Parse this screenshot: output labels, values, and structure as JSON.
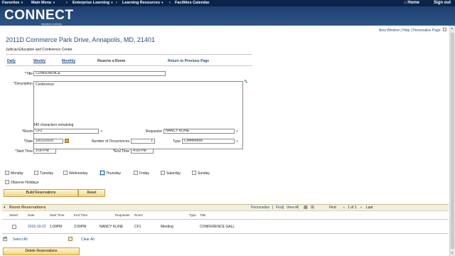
{
  "topnav": {
    "items": [
      "Favorites",
      "Main Menu",
      "Enterprise Learning",
      "Learning Resources",
      "Facilities Calendar"
    ],
    "home": "Home",
    "signout": "Sign out"
  },
  "brand": {
    "name": "CONNECT",
    "sub": "Maryland Judiciary",
    "header_color": "#0a2447"
  },
  "toplinks": {
    "new_window": "New Window",
    "help": "Help",
    "personalize": "Personalize Page"
  },
  "header": {
    "address": "2011D Commerce Park Drive,   Annapolis, MD, 21401",
    "center": "Judicial Education and Conference Center"
  },
  "tabs": {
    "daily": "Daily",
    "weekly": "Weekly",
    "monthly": "Monthly",
    "reserve": "Reserve a Room",
    "return": "Return to Previous Page"
  },
  "form": {
    "title_label": "*Title",
    "title_value": "CONFERENCE",
    "description_label": "*Description",
    "description_value": "Conference",
    "chars_remaining": "240 characters remaining",
    "room_label": "*Room",
    "room_value": "CF2",
    "requestor_label": "Requestor",
    "requestor_value": "NANCY KLINE",
    "date_label": "*Date",
    "date_value": "10/22/2015",
    "occurrences_label": "Number of Occurrences",
    "occurrences_value": "1",
    "type_label": "Type",
    "type_value": "Conference",
    "start_label": "*Start Time",
    "start_value": "3:00 PM",
    "end_label": "*End Time",
    "end_value": "4:00 PM"
  },
  "days": {
    "monday": "Monday",
    "tuesday": "Tuesday",
    "wednesday": "Wednesday",
    "thursday": "Thursday",
    "friday": "Friday",
    "saturday": "Saturday",
    "sunday": "Sunday",
    "holidays": "Observe Holidays"
  },
  "buttons": {
    "build": "Build Reservations",
    "reset": "Reset",
    "delete": "Delete Reservations"
  },
  "grid": {
    "title": "Room Reservations",
    "personalize": "Personalize",
    "find": "Find",
    "view_all": "View All",
    "first": "First",
    "pager": "1 of 1",
    "last": "Last",
    "columns": {
      "select": "Select",
      "date": "Date",
      "start": "Start Time",
      "end": "End Time",
      "requester": "Requester",
      "room": "Room",
      "type": "Type",
      "title": "Title"
    },
    "row": {
      "date": "2015-10-22",
      "start": "1:00PM",
      "end": "2:00PM",
      "requester": "NANCY KLINE",
      "room": "CF1",
      "type": "Meeting",
      "title": "CONFERENCE GALL"
    }
  },
  "select_all": "Select All",
  "clear_all": "Clear All"
}
